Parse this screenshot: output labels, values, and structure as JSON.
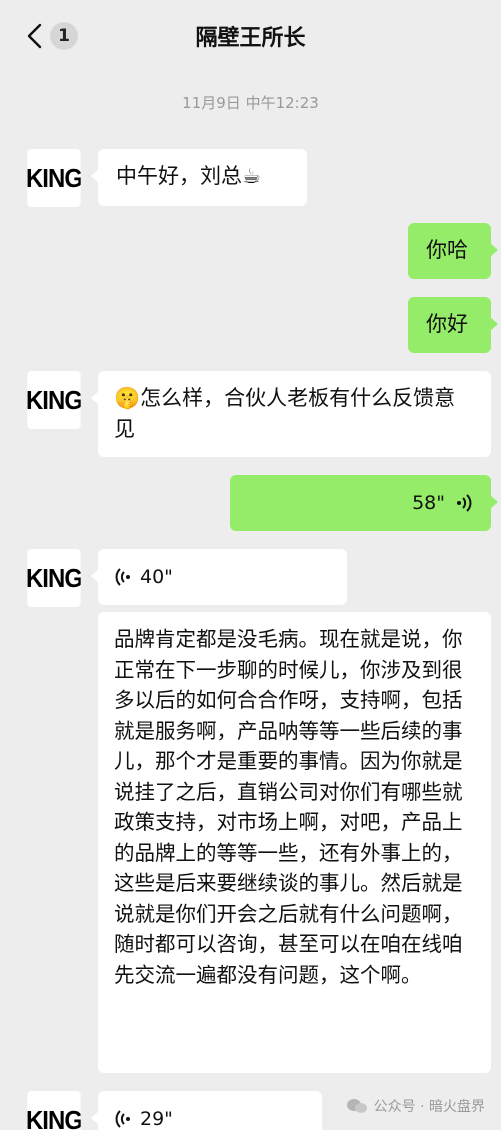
{
  "header": {
    "back_badge": "1",
    "title": "隔壁王所长"
  },
  "timestamp": "11月9日 中午12:23",
  "contact": {
    "avatar_text": "KING"
  },
  "messages": [
    {
      "sender": "contact",
      "type": "text",
      "text": "中午好，刘总☕"
    },
    {
      "sender": "me",
      "type": "text",
      "text": "你哈"
    },
    {
      "sender": "me",
      "type": "text",
      "text": "你好"
    },
    {
      "sender": "contact",
      "type": "text",
      "emoji": "🤫",
      "text": "怎么样，合伙人老板有什么反馈意见"
    },
    {
      "sender": "me",
      "type": "voice",
      "duration": "58\""
    },
    {
      "sender": "contact",
      "type": "voice",
      "duration": "40\""
    },
    {
      "sender": "contact",
      "type": "transcript",
      "text": "品牌肯定都是没毛病。现在就是说，你正常在下一步聊的时候儿，你涉及到很多以后的如何合合作呀，支持啊，包括就是服务啊，产品呐等等一些后续的事儿，那个才是重要的事情。因为你就是说挂了之后，直销公司对你们有哪些就政策支持，对市场上啊，对吧，产品上的品牌上的等等一些，还有外事上的，这些是后来要继续谈的事儿。然后就是说就是你们开会之后就有什么问题啊，随时都可以咨询，甚至可以在咱在线咱先交流一遍都没有问题，这个啊。"
    },
    {
      "sender": "contact",
      "type": "voice",
      "duration": "29\""
    }
  ],
  "watermark": "公众号 · 暗火盘界",
  "colors": {
    "background": "#ededed",
    "outgoing": "#95ec69",
    "incoming": "#ffffff"
  }
}
